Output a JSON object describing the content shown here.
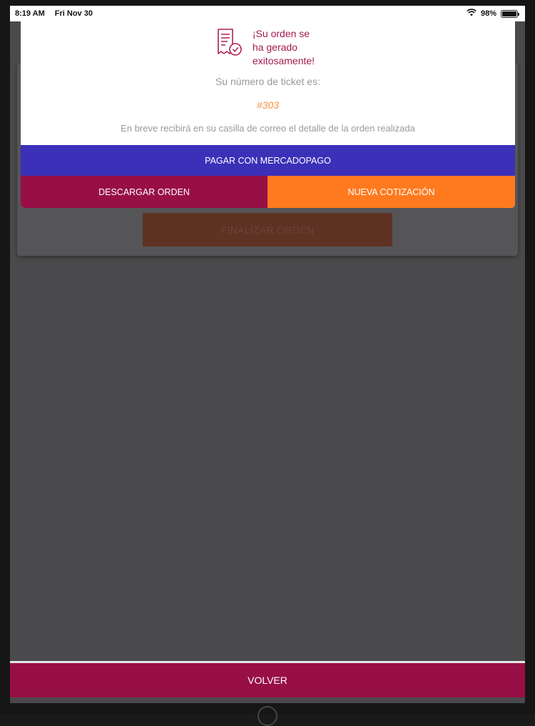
{
  "status_bar": {
    "time": "8:19 AM",
    "date": "Fri Nov 30",
    "battery": "98%",
    "battery_level": 0.98
  },
  "modal": {
    "success_title": "¡Su orden se\nha gerado\nexitosamente!",
    "ticket_label": "Su número de ticket es:",
    "ticket_number": "#303",
    "info_text": "En breve recibirá en su casilla de correo el detalle de la orden realizada",
    "pay_button": "PAGAR CON MERCADOPAGO",
    "download_button": "DESCARGAR ORDEN",
    "new_quote_button": "NUEVA COTIZACIÓN"
  },
  "background": {
    "finalize_button": "FINALIZAR ORDEN"
  },
  "footer": {
    "back_button": "VOLVER"
  },
  "colors": {
    "accent_magenta": "#970f45",
    "pay_blue": "#3b30b8",
    "accent_orange": "#ff7a1f",
    "ticket_orange": "#f5933f"
  },
  "icons": {
    "success": "receipt-check-icon",
    "wifi": "wifi-icon",
    "battery": "battery-icon"
  }
}
